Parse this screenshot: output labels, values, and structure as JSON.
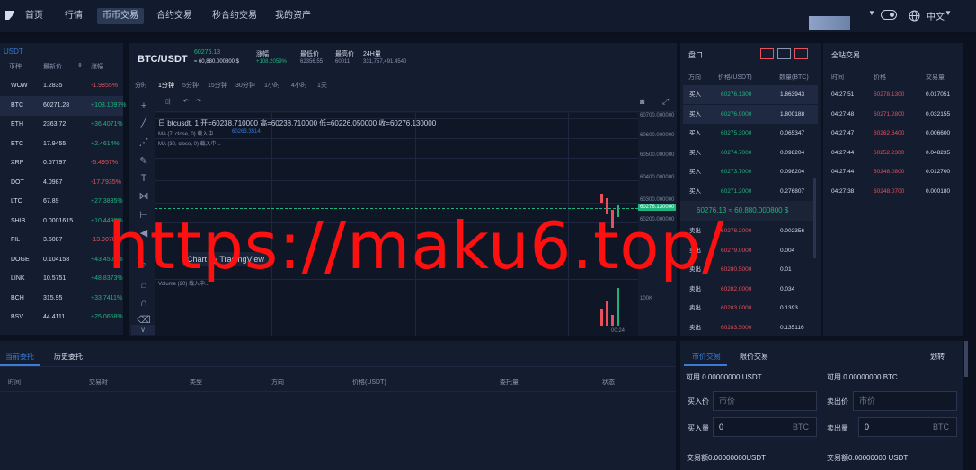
{
  "nav": {
    "items": [
      "首页",
      "行情",
      "币币交易",
      "合约交易",
      "秒合约交易",
      "我的资产"
    ],
    "active_index": 2,
    "language": "中文"
  },
  "market": {
    "tab": "USDT",
    "headers": [
      "币种",
      "最新价",
      "涨幅"
    ],
    "rows": [
      {
        "sym": "WOW",
        "price": "1.2835",
        "chg": "-1.9855%",
        "dir": "down"
      },
      {
        "sym": "BTC",
        "price": "60271.28",
        "chg": "+108.1097%",
        "dir": "up"
      },
      {
        "sym": "ETH",
        "price": "2363.72",
        "chg": "+36.4071%",
        "dir": "up"
      },
      {
        "sym": "ETC",
        "price": "17.9455",
        "chg": "+2.4614%",
        "dir": "up"
      },
      {
        "sym": "XRP",
        "price": "0.57797",
        "chg": "-5.4957%",
        "dir": "down"
      },
      {
        "sym": "DOT",
        "price": "4.0987",
        "chg": "-17.7935%",
        "dir": "down"
      },
      {
        "sym": "LTC",
        "price": "67.89",
        "chg": "+27.3835%",
        "dir": "up"
      },
      {
        "sym": "SHIB",
        "price": "0.0001615",
        "chg": "+10.4493%",
        "dir": "up"
      },
      {
        "sym": "FIL",
        "price": "3.5087",
        "chg": "-13.9070%",
        "dir": "down"
      },
      {
        "sym": "DOGE",
        "price": "0.104158",
        "chg": "+43.4505%",
        "dir": "up"
      },
      {
        "sym": "LINK",
        "price": "10.5751",
        "chg": "+48.8373%",
        "dir": "up"
      },
      {
        "sym": "BCH",
        "price": "315.95",
        "chg": "+33.7411%",
        "dir": "up"
      },
      {
        "sym": "BSV",
        "price": "44.4111",
        "chg": "+25.0658%",
        "dir": "up"
      }
    ]
  },
  "ticker": {
    "pair": "BTC/USDT",
    "price": "60276.13",
    "price_fiat": "≈ 60,880.000800 $",
    "change_label": "涨幅",
    "change_value": "+108.2059%",
    "low_label": "最低价",
    "low_value": "62356.55",
    "high_label": "最高价",
    "high_value": "60011",
    "vol_label": "24H量",
    "vol_value": "331,757,491.4540"
  },
  "chart": {
    "intervals": [
      "分时",
      "1分钟",
      "5分钟",
      "15分钟",
      "30分钟",
      "1小时",
      "4小时",
      "1天"
    ],
    "active_interval": 1,
    "ohlc_line": "日 btcusdt, 1   开=60238.710000  高=60238.710000  低=60226.050000  收=60276.130000",
    "ma7": "MA (7, close, 0) 载入中...",
    "ma7_value": "60263.3514",
    "ma30": "MA (30, close, 0) 载入中...",
    "price_axis": [
      "60700.000000",
      "60600.000000",
      "60500.000000",
      "60400.000000",
      "60300.000000",
      "60200.000000"
    ],
    "last_price_tag": "60276.130000",
    "tv_brand": "Chart by TradingView",
    "volume_label": "Volume (20) 载入中...",
    "volume_axis": "100K",
    "time_label": "00:24"
  },
  "orderbook": {
    "title": "盘口",
    "headers": [
      "方向",
      "价格(USDT)",
      "数量(BTC)"
    ],
    "buy_label": "买入",
    "sell_label": "卖出",
    "bids": [
      {
        "price": "60276.1300",
        "qty": "1.863943"
      },
      {
        "price": "60276.0000",
        "qty": "1.800188"
      },
      {
        "price": "60275.3000",
        "qty": "0.065347"
      },
      {
        "price": "60274.7000",
        "qty": "0.098204"
      },
      {
        "price": "60273.7000",
        "qty": "0.098204"
      },
      {
        "price": "60271.2000",
        "qty": "0.276807"
      }
    ],
    "mid_price": "60276.13 ≈ 60,880.000800 $",
    "asks": [
      {
        "price": "60278.2000",
        "qty": "0.002356"
      },
      {
        "price": "60279.0000",
        "qty": "0.004"
      },
      {
        "price": "60280.5000",
        "qty": "0.01"
      },
      {
        "price": "60282.0000",
        "qty": "0.034"
      },
      {
        "price": "60283.0000",
        "qty": "0.1393"
      },
      {
        "price": "60283.5000",
        "qty": "0.135116"
      }
    ]
  },
  "trades": {
    "title": "全站交易",
    "headers": [
      "时间",
      "价格",
      "交易量"
    ],
    "rows": [
      {
        "time": "04:27:51",
        "price": "60278.1300",
        "qty": "0.017051",
        "dir": "down"
      },
      {
        "time": "04:27:48",
        "price": "60271.2800",
        "qty": "0.032155",
        "dir": "down"
      },
      {
        "time": "04:27:47",
        "price": "60262.6400",
        "qty": "0.006600",
        "dir": "down"
      },
      {
        "time": "04:27:44",
        "price": "60252.2300",
        "qty": "0.048235",
        "dir": "down"
      },
      {
        "time": "04:27:44",
        "price": "60248.0800",
        "qty": "0.012700",
        "dir": "down"
      },
      {
        "time": "04:27:38",
        "price": "60248.0700",
        "qty": "0.000180",
        "dir": "down"
      }
    ]
  },
  "orders": {
    "tabs": [
      "当前委托",
      "历史委托"
    ],
    "columns": [
      "时间",
      "交易对",
      "类型",
      "方向",
      "价格(USDT)",
      "委托量",
      "状态"
    ]
  },
  "trade_form": {
    "tabs": [
      "市价交易",
      "限价交易"
    ],
    "right_link": "划转",
    "buy_avail": "可用 0.00000000 USDT",
    "sell_avail": "可用 0.00000000 BTC",
    "buy_price_label": "买入价",
    "sell_price_label": "卖出价",
    "price_placeholder": "市价",
    "buy_qty_label": "买入量",
    "sell_qty_label": "卖出量",
    "qty_value": "0",
    "qty_unit": "BTC",
    "buy_total": "交易额0.00000000USDT",
    "sell_total": "交易额0.00000000 USDT"
  },
  "watermark": "https://maku6.top/",
  "colors": {
    "up": "#21b37f",
    "down": "#e8505b",
    "accent": "#3a7bd5",
    "bg": "#0c1120",
    "panel": "#141c2f"
  }
}
